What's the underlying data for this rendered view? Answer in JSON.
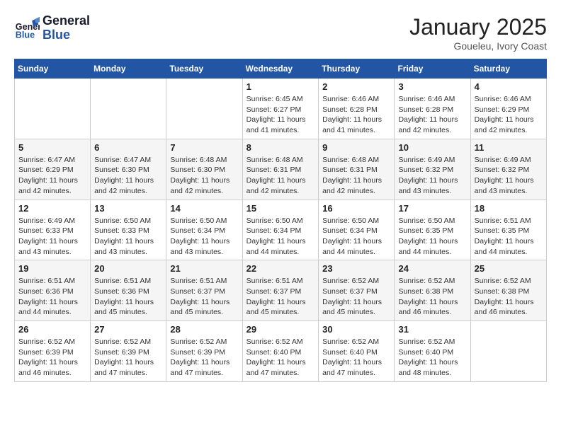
{
  "header": {
    "logo_line1": "General",
    "logo_line2": "Blue",
    "month": "January 2025",
    "location": "Goueleu, Ivory Coast"
  },
  "weekdays": [
    "Sunday",
    "Monday",
    "Tuesday",
    "Wednesday",
    "Thursday",
    "Friday",
    "Saturday"
  ],
  "weeks": [
    [
      {
        "day": "",
        "info": ""
      },
      {
        "day": "",
        "info": ""
      },
      {
        "day": "",
        "info": ""
      },
      {
        "day": "1",
        "info": "Sunrise: 6:45 AM\nSunset: 6:27 PM\nDaylight: 11 hours\nand 41 minutes."
      },
      {
        "day": "2",
        "info": "Sunrise: 6:46 AM\nSunset: 6:28 PM\nDaylight: 11 hours\nand 41 minutes."
      },
      {
        "day": "3",
        "info": "Sunrise: 6:46 AM\nSunset: 6:28 PM\nDaylight: 11 hours\nand 42 minutes."
      },
      {
        "day": "4",
        "info": "Sunrise: 6:46 AM\nSunset: 6:29 PM\nDaylight: 11 hours\nand 42 minutes."
      }
    ],
    [
      {
        "day": "5",
        "info": "Sunrise: 6:47 AM\nSunset: 6:29 PM\nDaylight: 11 hours\nand 42 minutes."
      },
      {
        "day": "6",
        "info": "Sunrise: 6:47 AM\nSunset: 6:30 PM\nDaylight: 11 hours\nand 42 minutes."
      },
      {
        "day": "7",
        "info": "Sunrise: 6:48 AM\nSunset: 6:30 PM\nDaylight: 11 hours\nand 42 minutes."
      },
      {
        "day": "8",
        "info": "Sunrise: 6:48 AM\nSunset: 6:31 PM\nDaylight: 11 hours\nand 42 minutes."
      },
      {
        "day": "9",
        "info": "Sunrise: 6:48 AM\nSunset: 6:31 PM\nDaylight: 11 hours\nand 42 minutes."
      },
      {
        "day": "10",
        "info": "Sunrise: 6:49 AM\nSunset: 6:32 PM\nDaylight: 11 hours\nand 43 minutes."
      },
      {
        "day": "11",
        "info": "Sunrise: 6:49 AM\nSunset: 6:32 PM\nDaylight: 11 hours\nand 43 minutes."
      }
    ],
    [
      {
        "day": "12",
        "info": "Sunrise: 6:49 AM\nSunset: 6:33 PM\nDaylight: 11 hours\nand 43 minutes."
      },
      {
        "day": "13",
        "info": "Sunrise: 6:50 AM\nSunset: 6:33 PM\nDaylight: 11 hours\nand 43 minutes."
      },
      {
        "day": "14",
        "info": "Sunrise: 6:50 AM\nSunset: 6:34 PM\nDaylight: 11 hours\nand 43 minutes."
      },
      {
        "day": "15",
        "info": "Sunrise: 6:50 AM\nSunset: 6:34 PM\nDaylight: 11 hours\nand 44 minutes."
      },
      {
        "day": "16",
        "info": "Sunrise: 6:50 AM\nSunset: 6:34 PM\nDaylight: 11 hours\nand 44 minutes."
      },
      {
        "day": "17",
        "info": "Sunrise: 6:50 AM\nSunset: 6:35 PM\nDaylight: 11 hours\nand 44 minutes."
      },
      {
        "day": "18",
        "info": "Sunrise: 6:51 AM\nSunset: 6:35 PM\nDaylight: 11 hours\nand 44 minutes."
      }
    ],
    [
      {
        "day": "19",
        "info": "Sunrise: 6:51 AM\nSunset: 6:36 PM\nDaylight: 11 hours\nand 44 minutes."
      },
      {
        "day": "20",
        "info": "Sunrise: 6:51 AM\nSunset: 6:36 PM\nDaylight: 11 hours\nand 45 minutes."
      },
      {
        "day": "21",
        "info": "Sunrise: 6:51 AM\nSunset: 6:37 PM\nDaylight: 11 hours\nand 45 minutes."
      },
      {
        "day": "22",
        "info": "Sunrise: 6:51 AM\nSunset: 6:37 PM\nDaylight: 11 hours\nand 45 minutes."
      },
      {
        "day": "23",
        "info": "Sunrise: 6:52 AM\nSunset: 6:37 PM\nDaylight: 11 hours\nand 45 minutes."
      },
      {
        "day": "24",
        "info": "Sunrise: 6:52 AM\nSunset: 6:38 PM\nDaylight: 11 hours\nand 46 minutes."
      },
      {
        "day": "25",
        "info": "Sunrise: 6:52 AM\nSunset: 6:38 PM\nDaylight: 11 hours\nand 46 minutes."
      }
    ],
    [
      {
        "day": "26",
        "info": "Sunrise: 6:52 AM\nSunset: 6:39 PM\nDaylight: 11 hours\nand 46 minutes."
      },
      {
        "day": "27",
        "info": "Sunrise: 6:52 AM\nSunset: 6:39 PM\nDaylight: 11 hours\nand 47 minutes."
      },
      {
        "day": "28",
        "info": "Sunrise: 6:52 AM\nSunset: 6:39 PM\nDaylight: 11 hours\nand 47 minutes."
      },
      {
        "day": "29",
        "info": "Sunrise: 6:52 AM\nSunset: 6:40 PM\nDaylight: 11 hours\nand 47 minutes."
      },
      {
        "day": "30",
        "info": "Sunrise: 6:52 AM\nSunset: 6:40 PM\nDaylight: 11 hours\nand 47 minutes."
      },
      {
        "day": "31",
        "info": "Sunrise: 6:52 AM\nSunset: 6:40 PM\nDaylight: 11 hours\nand 48 minutes."
      },
      {
        "day": "",
        "info": ""
      }
    ]
  ]
}
